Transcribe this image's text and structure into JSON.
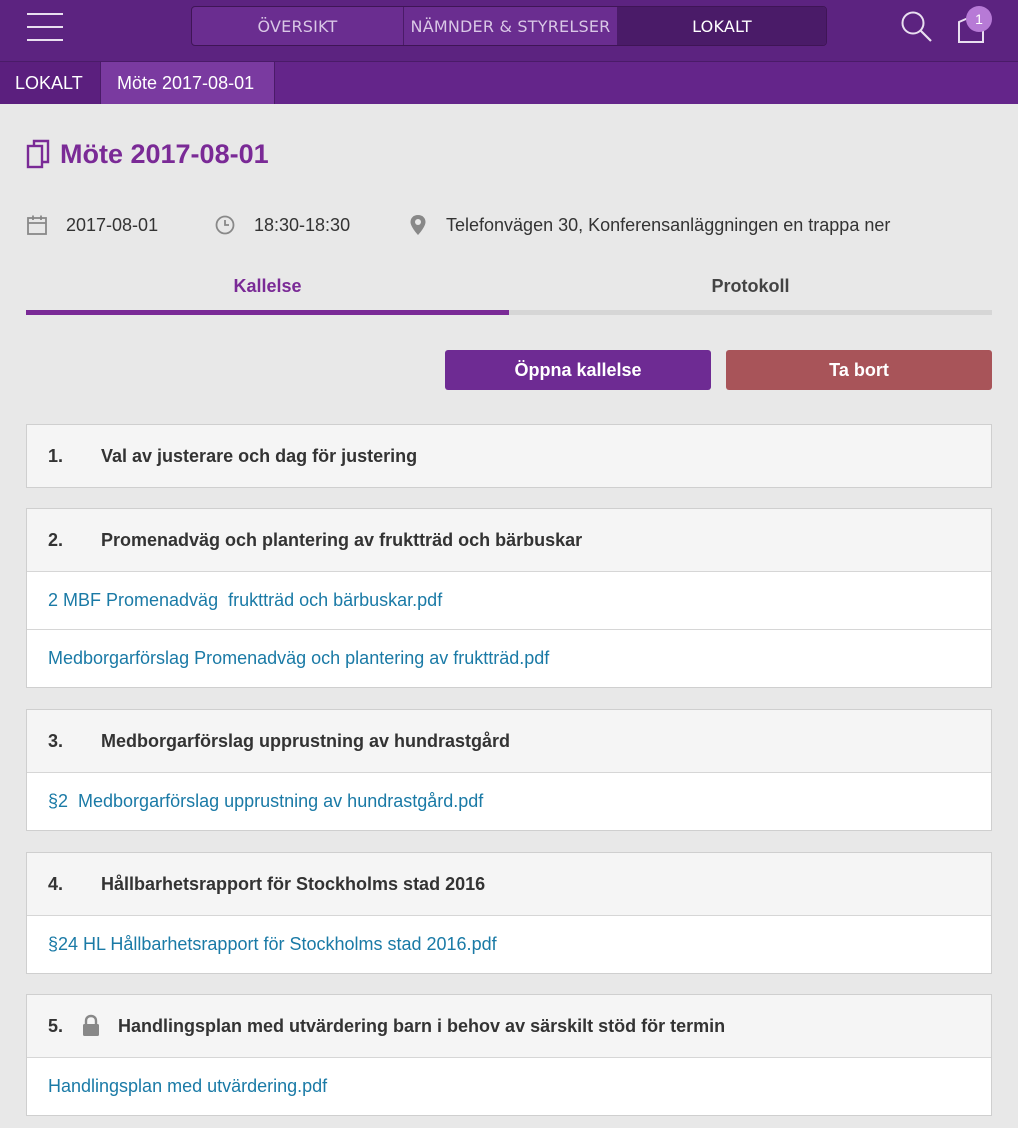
{
  "header": {
    "nav": [
      "ÖVERSIKT",
      "NÄMNDER & STYRELSER",
      "LOKALT"
    ],
    "active_nav": "LOKALT",
    "cart_count": "1"
  },
  "breadcrumb": [
    "LOKALT",
    "Möte 2017-08-01"
  ],
  "meeting": {
    "title": "Möte 2017-08-01",
    "date": "2017-08-01",
    "time": "18:30-18:30",
    "location": "Telefonvägen 30, Konferensanläggningen en trappa ner"
  },
  "tabs": [
    "Kallelse",
    "Protokoll"
  ],
  "active_tab": "Kallelse",
  "actions": {
    "open_label": "Öppna kallelse",
    "delete_label": "Ta bort"
  },
  "agenda": [
    {
      "num": "1.",
      "title": "Val av justerare och dag för justering",
      "locked": false,
      "attachments": []
    },
    {
      "num": "2.",
      "title": "Promenadväg och plantering av fruktträd och bärbuskar",
      "locked": false,
      "attachments": [
        "2 MBF Promenadväg  fruktträd och bärbuskar.pdf",
        "Medborgarförslag Promenadväg och plantering av fruktträd.pdf"
      ]
    },
    {
      "num": "3.",
      "title": "Medborgarförslag upprustning av hundrastgård",
      "locked": false,
      "attachments": [
        "§2  Medborgarförslag upprustning av hundrastgård.pdf"
      ]
    },
    {
      "num": "4.",
      "title": "Hållbarhetsrapport för Stockholms stad 2016",
      "locked": false,
      "attachments": [
        "§24 HL Hållbarhetsrapport för Stockholms stad 2016.pdf"
      ]
    },
    {
      "num": "5.",
      "title": "Handlingsplan med utvärdering barn i behov av särskilt stöd för termin",
      "locked": true,
      "attachments": [
        "Handlingsplan med utvärdering.pdf"
      ]
    }
  ],
  "colors": {
    "brand": "#5c2380",
    "accent": "#7a2a96",
    "danger": "#a85459",
    "link": "#1a7aa6"
  }
}
